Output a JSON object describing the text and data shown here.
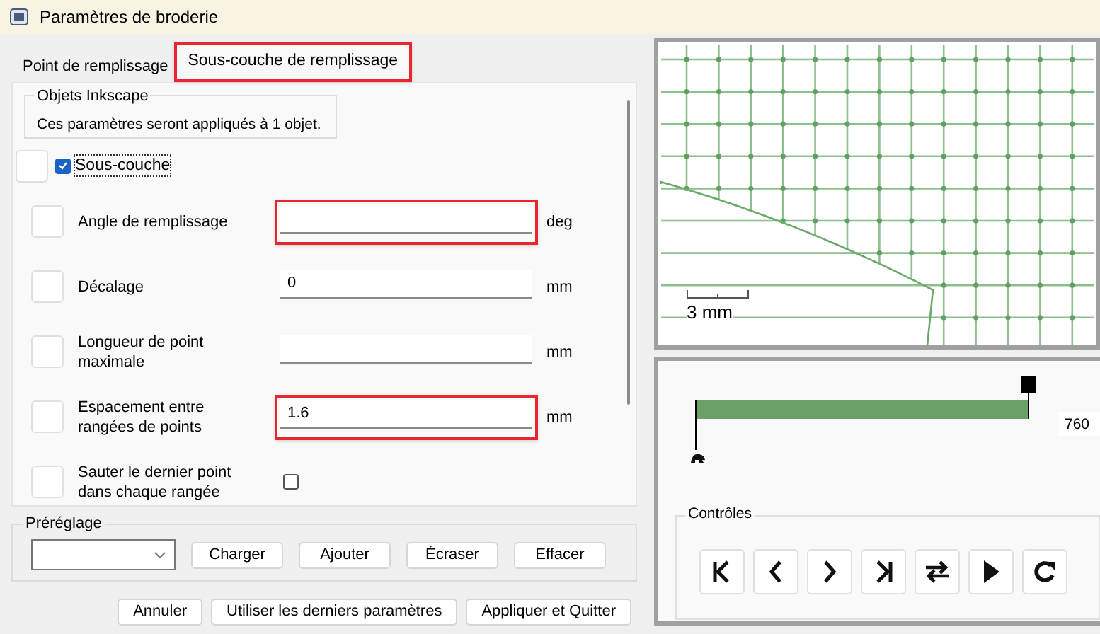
{
  "window": {
    "title": "Paramètres de broderie"
  },
  "tabs": [
    {
      "label": "Point de remplissage",
      "selected": false,
      "highlighted": false
    },
    {
      "label": "Sous-couche de remplissage",
      "selected": true,
      "highlighted": true
    }
  ],
  "objects_group": {
    "title": "Objets Inkscape",
    "message": "Ces paramètres seront appliqués à 1 objet."
  },
  "underlay_toggle": {
    "label": "Sous-couche",
    "checked": true
  },
  "params": [
    {
      "kind": "field",
      "label": "Angle de remplissage",
      "unit": "deg",
      "highlighted": true
    },
    {
      "kind": "field",
      "label": "Décalage",
      "value": "0",
      "unit": "mm",
      "highlighted": false
    },
    {
      "kind": "field",
      "label": "Longueur de point maximale",
      "unit": "mm",
      "highlighted": false
    },
    {
      "kind": "field",
      "label": "Espacement entre rangées de points",
      "value": "1.6",
      "unit": "mm",
      "highlighted": true
    },
    {
      "kind": "checkbox",
      "label": "Sauter le dernier point dans chaque rangée",
      "checked": false
    }
  ],
  "preset": {
    "title": "Préréglage",
    "buttons": [
      "Charger",
      "Ajouter",
      "Écraser",
      "Effacer"
    ]
  },
  "footer_buttons": [
    "Annuler",
    "Utiliser les derniers paramètres",
    "Appliquer et Quitter"
  ],
  "preview": {
    "scale_label": "3 mm"
  },
  "simulator": {
    "slider": {
      "level": 1
    },
    "stitch_count": "760",
    "controls_title": "Contrôles"
  }
}
